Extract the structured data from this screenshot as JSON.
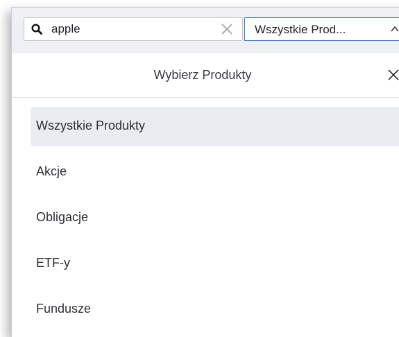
{
  "search": {
    "value": "apple",
    "icon": "search-icon",
    "clear_icon": "close-icon"
  },
  "product_select": {
    "value": "Wszystkie Prod...",
    "icon": "chevron-up-icon",
    "border_color": "#3a78c9"
  },
  "sheet": {
    "title": "Wybierz Produkty",
    "close_icon": "close-icon"
  },
  "options": [
    {
      "label": "Wszystkie Produkty",
      "selected": true
    },
    {
      "label": "Akcje",
      "selected": false
    },
    {
      "label": "Obligacje",
      "selected": false
    },
    {
      "label": "ETF-y",
      "selected": false
    },
    {
      "label": "Fundusze",
      "selected": false
    }
  ],
  "colors": {
    "topbar_bg": "#eef1f4",
    "selected_bg": "#e9edf1",
    "text": "#2c3034"
  }
}
